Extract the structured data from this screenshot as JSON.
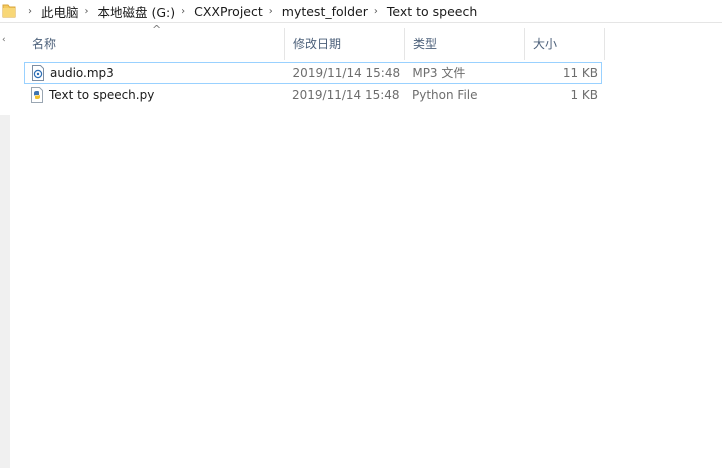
{
  "breadcrumb": {
    "items": [
      "此电脑",
      "本地磁盘 (G:)",
      "CXXProject",
      "mytest_folder",
      "Text to speech"
    ],
    "separator": "›"
  },
  "columns": {
    "name": "名称",
    "date": "修改日期",
    "type": "类型",
    "size": "大小",
    "sort_indicator": "^"
  },
  "files": [
    {
      "name": "audio.mp3",
      "date": "2019/11/14 15:48",
      "type": "MP3 文件",
      "size": "11 KB",
      "icon": "mp3-file-icon"
    },
    {
      "name": "Text to speech.py",
      "date": "2019/11/14 15:48",
      "type": "Python File",
      "size": "1 KB",
      "icon": "python-file-icon"
    }
  ],
  "colors": {
    "header_text": "#4c607a",
    "selection_border": "#99d1ff",
    "folder": "#e8b84a"
  }
}
